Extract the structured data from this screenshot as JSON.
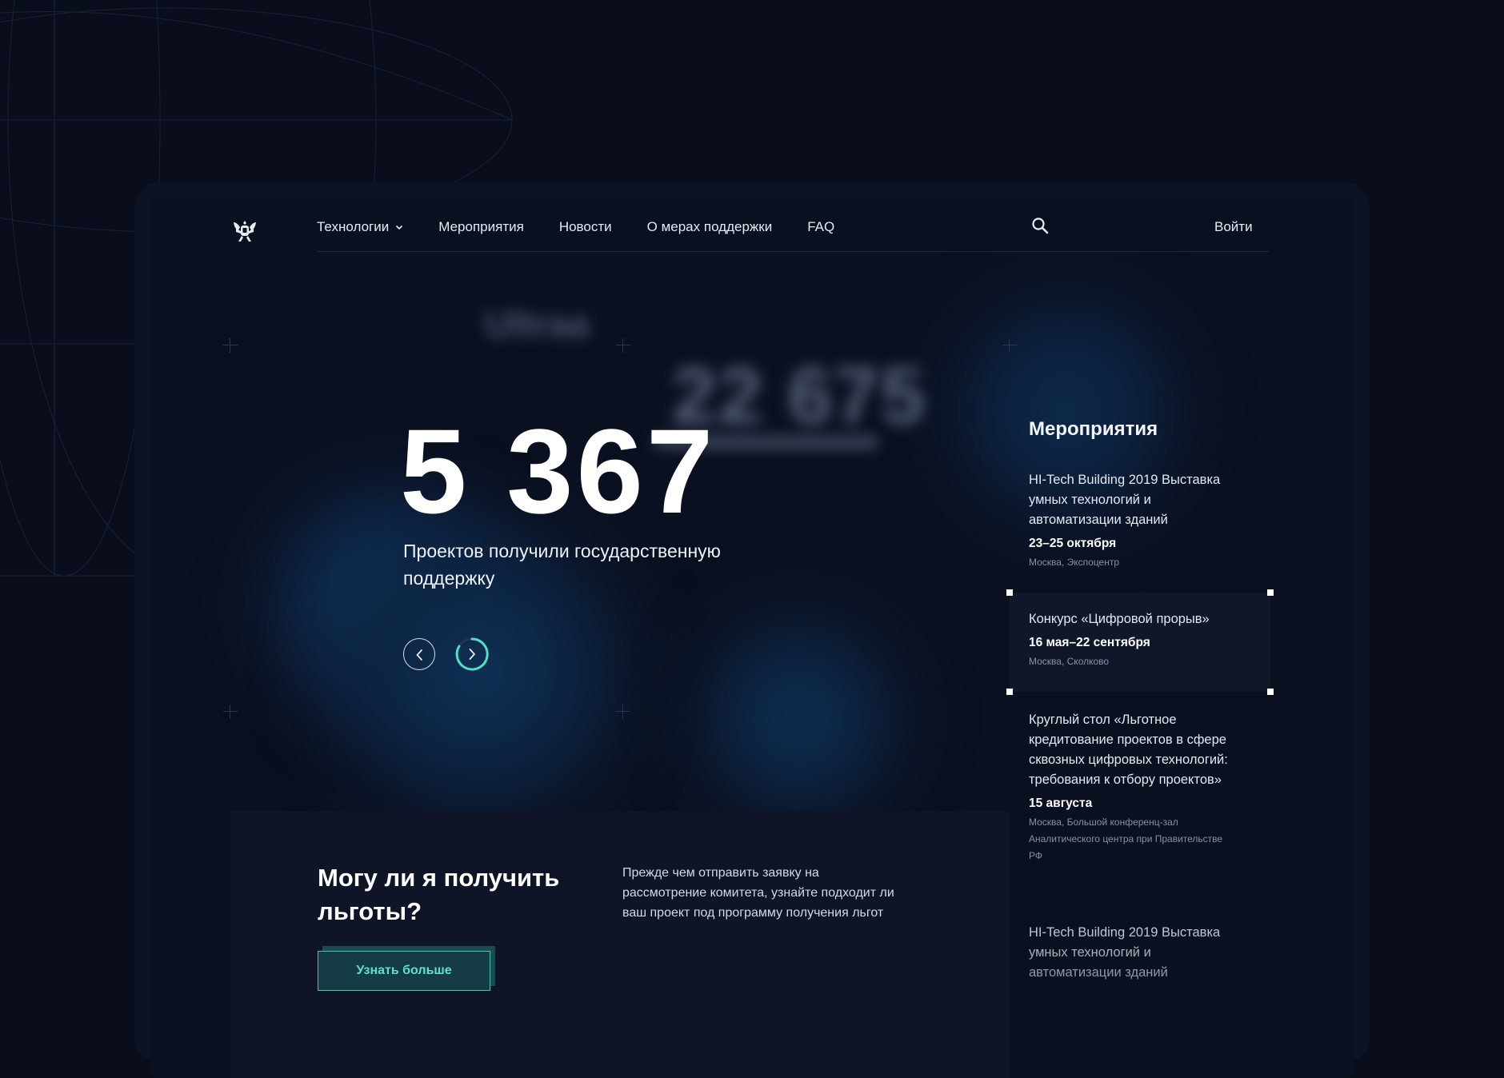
{
  "nav": {
    "items": [
      {
        "label": "Технологии",
        "has_dropdown": true
      },
      {
        "label": "Мероприятия",
        "has_dropdown": false
      },
      {
        "label": "Новости",
        "has_dropdown": false
      },
      {
        "label": "О мерах поддержки",
        "has_dropdown": false
      },
      {
        "label": "FAQ",
        "has_dropdown": false
      }
    ],
    "login_label": "Войти",
    "logo_icon": "double-headed-eagle-icon",
    "search_icon": "search-icon"
  },
  "hero": {
    "ghost_small": "Ultraa",
    "ghost_big": "22 675",
    "number": "5 367",
    "subtitle": "Проектов получили государственную поддержку",
    "prev_icon": "chevron-left-icon",
    "next_icon": "chevron-right-icon"
  },
  "events": {
    "title": "Мероприятия",
    "items": [
      {
        "title": "HI-Tech Building 2019 Выставка умных технологий и автоматизации зданий",
        "date": "23–25 октября",
        "location": "Москва, Экспоцентр"
      },
      {
        "title": "Конкурс «Цифровой прорыв»",
        "date": "16 мая–22 сентября",
        "location": "Москва, Сколково",
        "selected": true
      },
      {
        "title": "Круглый стол «Льготное кредитование проектов в сфере сквозных цифровых технологий: требования к отбору проектов»",
        "date": "15 августа",
        "location": "Москва, Большой конференц-зал Аналитического центра при Правительстве РФ"
      },
      {
        "title": "HI-Tech Building 2019 Выставка умных технологий и автоматизации зданий"
      }
    ]
  },
  "benefits": {
    "title": "Могу ли я получить льготы?",
    "description": "Прежде чем отправить заявку на рассмотрение комитета, узнайте подходит ли ваш проект под программу получения льгот",
    "button_label": "Узнать больше"
  },
  "colors": {
    "background": "#0a0e1c",
    "panel": "#0f1527",
    "accent": "#3cc9b3"
  }
}
